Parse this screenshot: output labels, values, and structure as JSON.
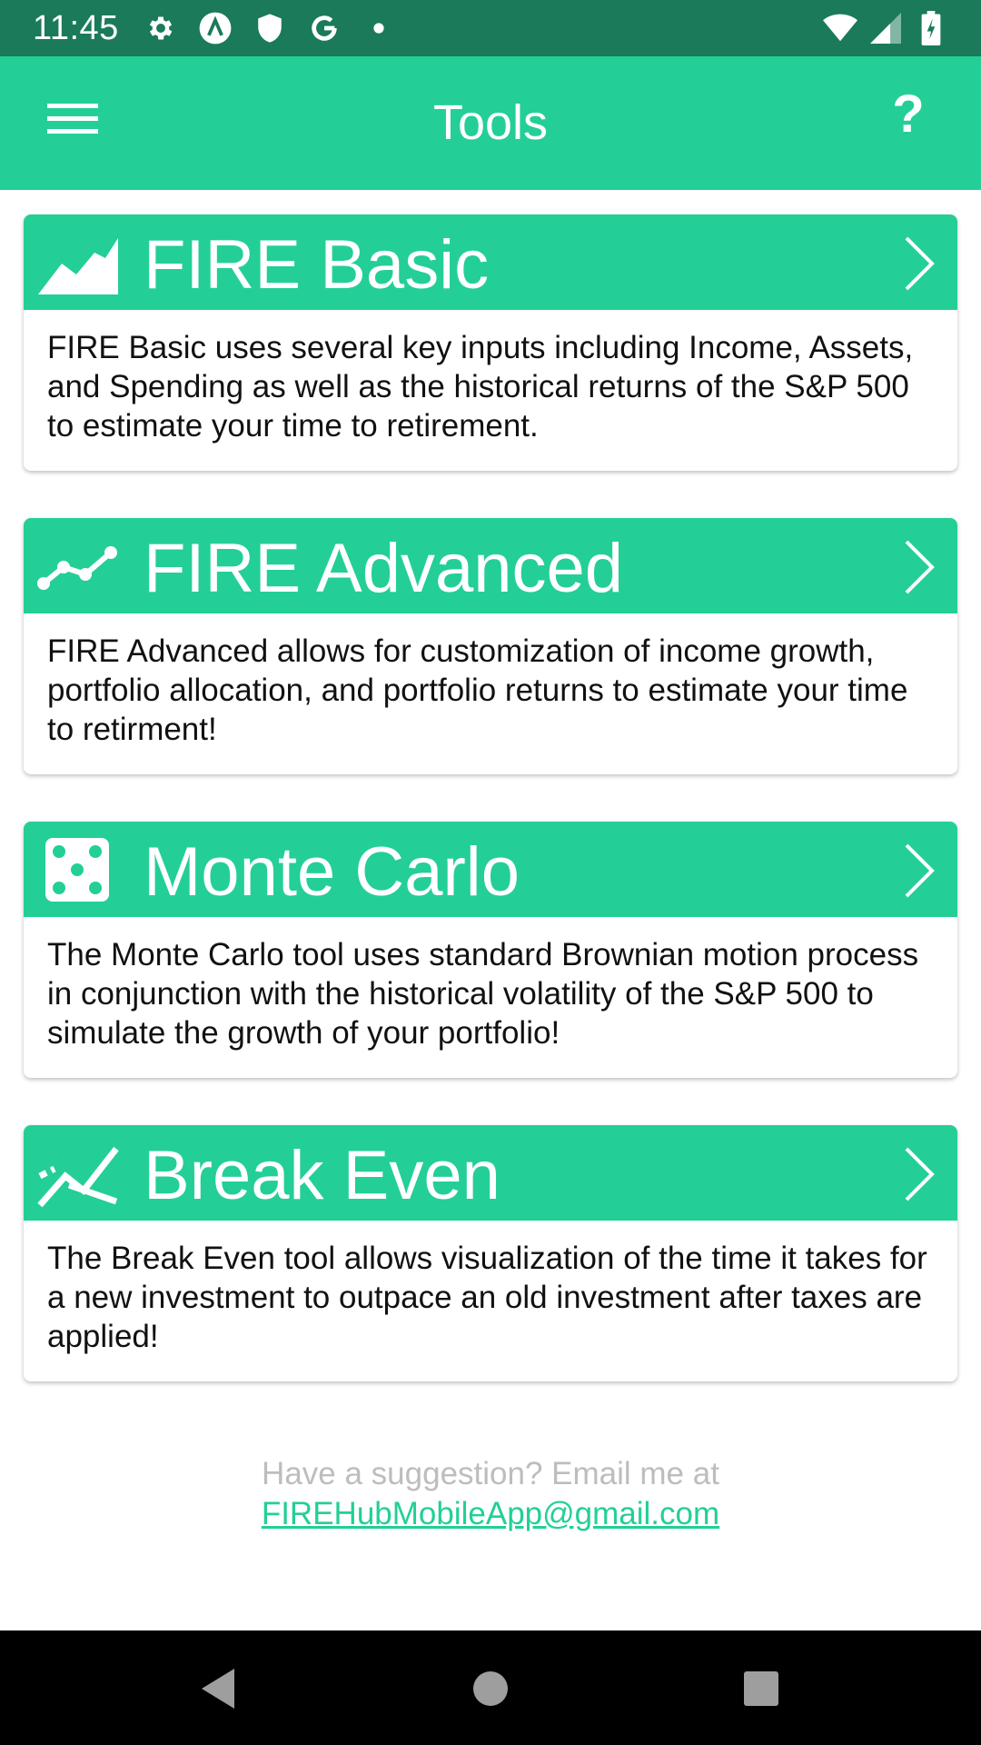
{
  "status_bar": {
    "time": "11:45",
    "left_icons": [
      "settings-icon",
      "a-circle-icon",
      "shield-icon",
      "google-icon",
      "dot-icon"
    ],
    "right_icons": [
      "wifi-icon",
      "signal-icon",
      "battery-icon"
    ]
  },
  "app_bar": {
    "title": "Tools",
    "help_label": "?"
  },
  "cards": [
    {
      "title": "FIRE Basic",
      "icon": "area-chart-icon",
      "description": "FIRE Basic uses several key inputs including Income, Assets, and Spending as well as the historical returns of the S&P 500 to estimate your time to retirement."
    },
    {
      "title": "FIRE Advanced",
      "icon": "line-chart-icon",
      "description": "FIRE Advanced allows for customization of income growth, portfolio allocation, and portfolio returns to estimate your time to retirment!"
    },
    {
      "title": "Monte Carlo",
      "icon": "dice-icon",
      "description": "The Monte Carlo tool uses standard Brownian motion process in conjunction with the historical volatility of the S&P 500 to simulate the growth of your portfolio!"
    },
    {
      "title": "Break Even",
      "icon": "crossing-lines-icon",
      "description": "The Break Even tool allows visualization of the time it takes for a new investment to outpace an old investment after taxes are applied!"
    }
  ],
  "footer": {
    "text": "Have a suggestion? Email me at",
    "email": "FIREHubMobileApp@gmail.com"
  },
  "colors": {
    "primary": "#23cf97",
    "status_bar": "#1a7a5a",
    "footer_text": "#bdbdbd"
  }
}
